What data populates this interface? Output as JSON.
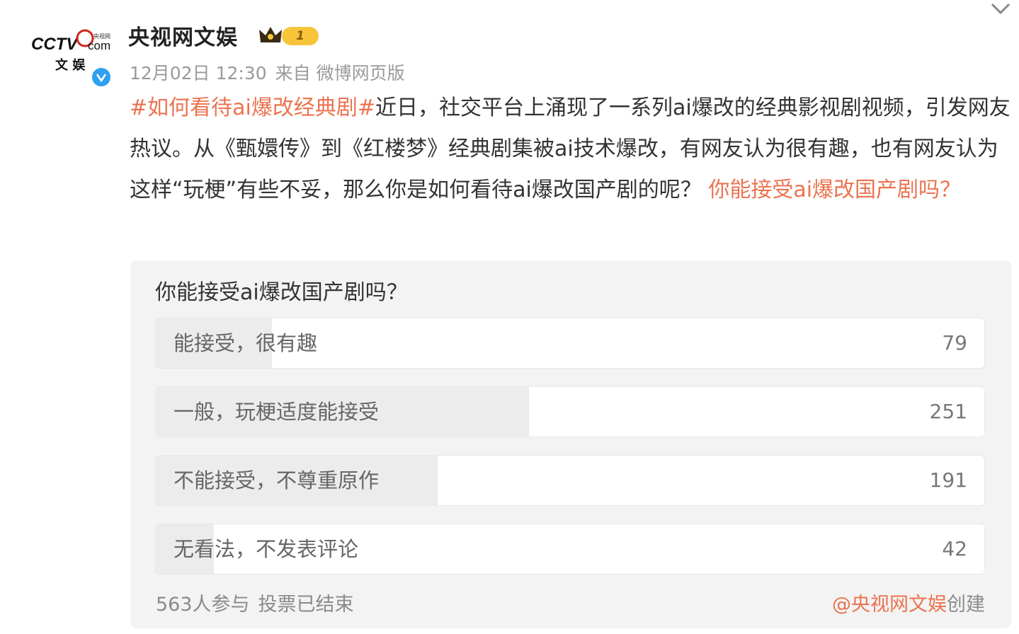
{
  "account": {
    "name": "央视网文娱",
    "logo_top": "CCTV",
    "logo_suffix": "com",
    "logo_sub": "文 娱",
    "logo_tiny": "央视网",
    "level": "1",
    "verified_icon": "verified-v-icon"
  },
  "post": {
    "date": "12月02日 12:30",
    "source": "来自 微博网页版",
    "hashtag": "#如何看待ai爆改经典剧#",
    "body": "近日，社交平台上涌现了一系列ai爆改的经典影视剧视频，引发网友热议。从《甄嬛传》到《红楼梦》经典剧集被ai技术爆改，有网友认为很有趣，也有网友认为这样“玩梗”有些不妥，那么你是如何看待ai爆改国产剧的呢？ ",
    "link": "你能接受ai爆改国产剧吗？"
  },
  "vote": {
    "question": "你能接受ai爆改国产剧吗？",
    "options": [
      {
        "label": "能接受，很有趣",
        "count": "79",
        "share": 0.14
      },
      {
        "label": "一般，玩梗适度能接受",
        "count": "251",
        "share": 0.45
      },
      {
        "label": "不能接受，不尊重原作",
        "count": "191",
        "share": 0.34
      },
      {
        "label": "无看法，不发表评论",
        "count": "42",
        "share": 0.07
      }
    ],
    "participants": "563人参与",
    "status": "投票已结束",
    "creator_handle": "@央视网文娱",
    "creator_suffix": "创建"
  },
  "colors": {
    "accent": "#eb7350",
    "verified": "#2f9ff0",
    "logo_red": "#d0261c",
    "badge": "#f7c43a"
  }
}
